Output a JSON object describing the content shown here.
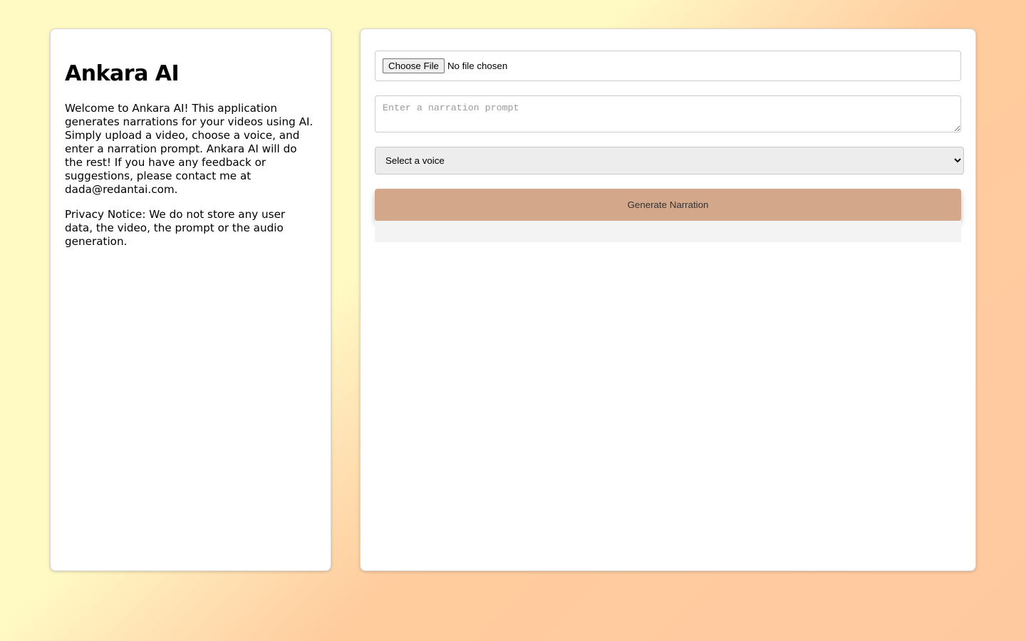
{
  "sidebar": {
    "title": "Ankara AI",
    "intro": "Welcome to Ankara AI! This application generates narrations for your videos using AI. Simply upload a video, choose a voice, and enter a narration prompt. Ankara AI will do the rest! If you have any feedback or suggestions, please contact me at dada@redantai.com.",
    "privacy": "Privacy Notice: We do not store any user data, the video, the prompt or the audio generation."
  },
  "form": {
    "file_button_label": "Choose File",
    "file_status": "No file chosen",
    "prompt_placeholder": "Enter a narration prompt",
    "prompt_value": "",
    "voice_selected": "Select a voice",
    "generate_label": "Generate Narration"
  },
  "colors": {
    "accent_button": "#d2a78a",
    "background_start": "#fff9c4",
    "background_end": "#ffc9a0"
  }
}
